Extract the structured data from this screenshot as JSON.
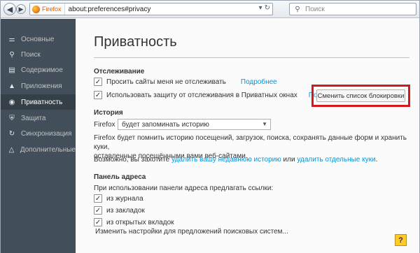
{
  "toolbar": {
    "back_icon": "back-arrow-icon",
    "forward_icon": "forward-arrow-icon",
    "identity_label": "Firefox",
    "url": "about:preferences#privacy",
    "search_placeholder": "Поиск"
  },
  "sidebar": {
    "items": [
      {
        "label": "Основные",
        "icon": "switch-icon"
      },
      {
        "label": "Поиск",
        "icon": "search-icon"
      },
      {
        "label": "Содержимое",
        "icon": "document-icon"
      },
      {
        "label": "Приложения",
        "icon": "rocket-icon"
      },
      {
        "label": "Приватность",
        "icon": "mask-icon",
        "active": true
      },
      {
        "label": "Защита",
        "icon": "shield-icon"
      },
      {
        "label": "Синхронизация",
        "icon": "sync-icon"
      },
      {
        "label": "Дополнительные",
        "icon": "wizard-icon"
      }
    ]
  },
  "main": {
    "title": "Приватность",
    "tracking": {
      "heading": "Отслеживание",
      "dnt_label": "Просить сайты меня не отслеживать",
      "dnt_more": "Подробнее",
      "tp_label": "Использовать защиту от отслеживания в Приватных окнах",
      "tp_more": "Подробнее",
      "change_blocklist": "Сменить список блокировки"
    },
    "history": {
      "heading": "История",
      "firefox_label": "Firefox",
      "select_value": "будет запоминать историю",
      "desc_line1": "Firefox будет помнить историю посещений, загрузок, поиска, сохранять данные форм и хранить куки,",
      "desc_line2": "оставленные посещёнными вами веб-сайтами.",
      "maybe_prefix": "Возможно, вы захотите",
      "clear_recent": "удалить вашу недавнюю историю",
      "or_text": "или",
      "remove_cookies": "удалить отдельные куки",
      "period": "."
    },
    "location": {
      "heading": "Панель адреса",
      "desc": "При использовании панели адреса предлагать ссылки:",
      "options": [
        "из журнала",
        "из закладок",
        "из открытых вкладок"
      ],
      "change_link": "Изменить настройки для предложений поисковых систем..."
    },
    "help_label": "?"
  },
  "colors": {
    "sidebar_bg": "#424f5a",
    "sidebar_active": "#343f48",
    "link": "#0095dd",
    "highlight": "#d3191d"
  }
}
